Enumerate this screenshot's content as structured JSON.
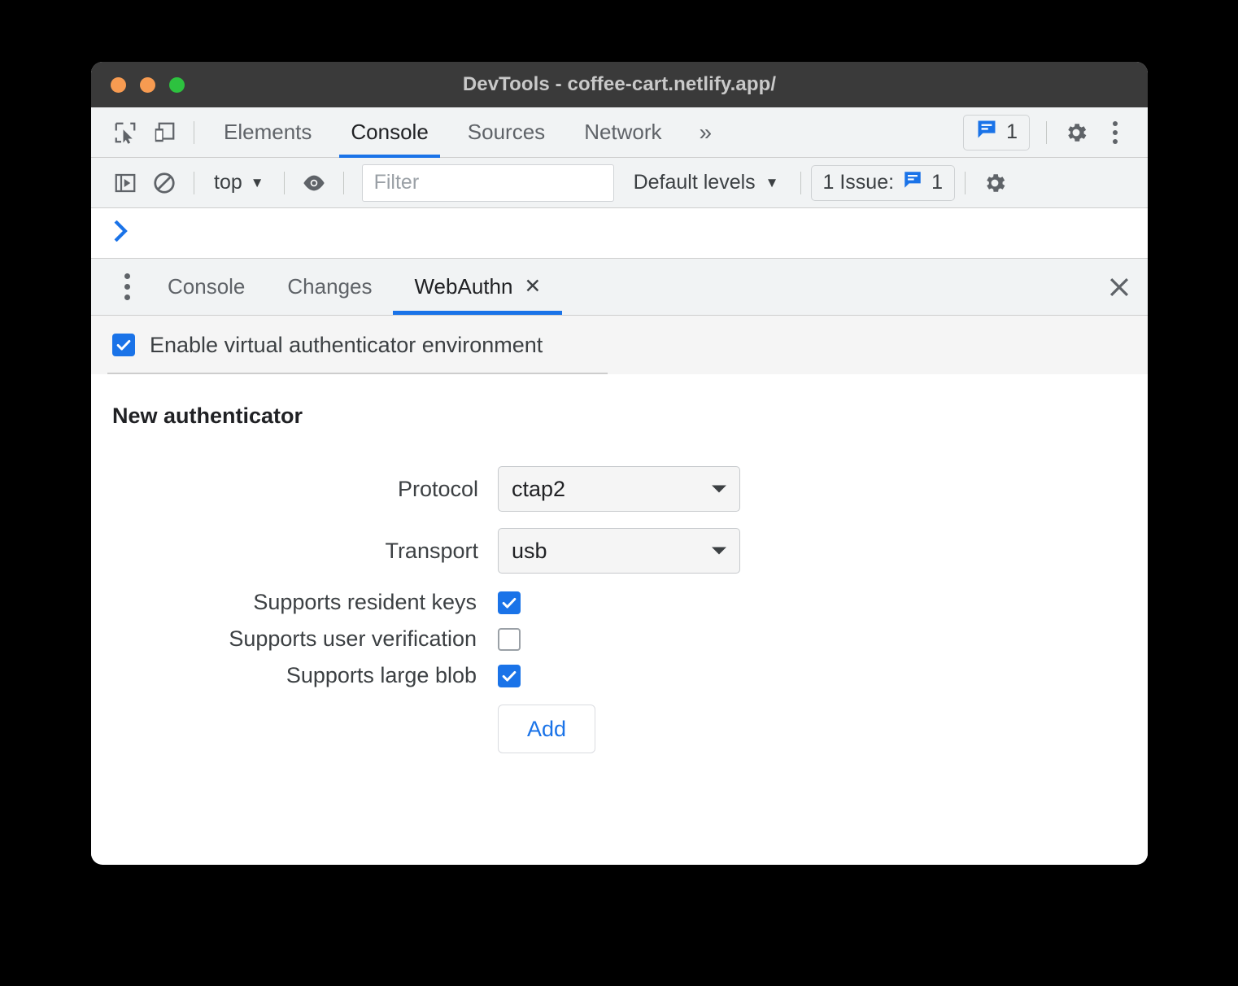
{
  "window": {
    "title": "DevTools - coffee-cart.netlify.app/",
    "traffic_lights": [
      "close-orange",
      "minimize-orange",
      "maximize-green"
    ]
  },
  "main_toolbar": {
    "inspect_icon": "inspect-element-icon",
    "device_icon": "device-toolbar-icon",
    "tabs": [
      {
        "label": "Elements",
        "active": false
      },
      {
        "label": "Console",
        "active": true
      },
      {
        "label": "Sources",
        "active": false
      },
      {
        "label": "Network",
        "active": false
      }
    ],
    "more_tabs": "»",
    "issues_badge": {
      "icon": "message-bubble-icon",
      "count": "1"
    },
    "settings_icon": "gear-icon",
    "menu_icon": "kebab-menu-icon"
  },
  "console_toolbar": {
    "sidebar_icon": "console-sidebar-icon",
    "clear_icon": "clear-console-icon",
    "context": "top",
    "context_caret": "▼",
    "eye_icon": "live-expression-eye-icon",
    "filter": {
      "placeholder": "Filter",
      "value": ""
    },
    "levels": "Default levels",
    "levels_caret": "▼",
    "issues": {
      "label": "1 Issue:",
      "icon": "message-bubble-icon",
      "count": "1"
    },
    "settings_icon": "gear-icon"
  },
  "console": {
    "prompt": "❯"
  },
  "drawer": {
    "menu_icon": "kebab-menu-icon",
    "tabs": [
      {
        "label": "Console",
        "active": false,
        "closable": false
      },
      {
        "label": "Changes",
        "active": false,
        "closable": false
      },
      {
        "label": "WebAuthn",
        "active": true,
        "closable": true,
        "close_glyph": "✕"
      }
    ],
    "close_glyph": "✕"
  },
  "webauthn": {
    "enable": {
      "label": "Enable virtual authenticator environment",
      "checked": true
    },
    "section_title": "New authenticator",
    "fields": [
      {
        "label": "Protocol",
        "value": "ctap2",
        "type": "select"
      },
      {
        "label": "Transport",
        "value": "usb",
        "type": "select"
      }
    ],
    "checkboxes": [
      {
        "label": "Supports resident keys",
        "checked": true
      },
      {
        "label": "Supports user verification",
        "checked": false
      },
      {
        "label": "Supports large blob",
        "checked": true
      }
    ],
    "add_button": "Add"
  },
  "colors": {
    "accent": "#1a73e8",
    "titlebar": "#3a3a3a",
    "toolbar": "#f1f3f4",
    "panel": "#ffffff",
    "backdrop": "#000000"
  }
}
